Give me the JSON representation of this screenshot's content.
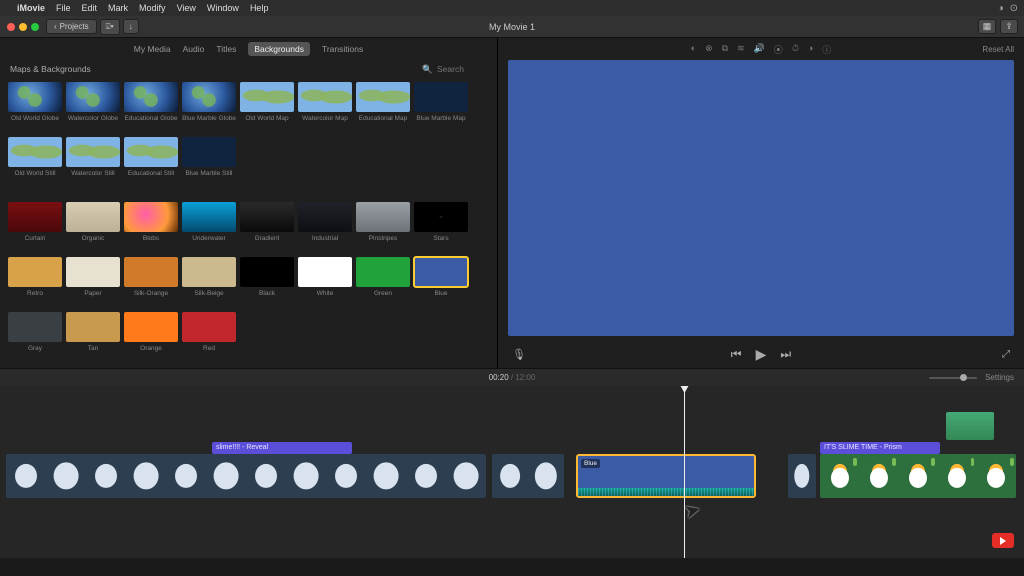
{
  "menubar": {
    "app": "iMovie",
    "items": [
      "File",
      "Edit",
      "Mark",
      "Modify",
      "View",
      "Window",
      "Help"
    ]
  },
  "toolbar": {
    "back_label": "Projects",
    "title": "My Movie 1"
  },
  "browser": {
    "tabs": {
      "my_media": "My Media",
      "audio": "Audio",
      "titles": "Titles",
      "backgrounds": "Backgrounds",
      "transitions": "Transitions"
    },
    "header": "Maps & Backgrounds",
    "search_placeholder": "Search",
    "row1": [
      {
        "label": "Old World Globe",
        "cls": "globe"
      },
      {
        "label": "Watercolor Globe",
        "cls": "globe"
      },
      {
        "label": "Educational Globe",
        "cls": "globe"
      },
      {
        "label": "Blue Marble Globe",
        "cls": "globe"
      },
      {
        "label": "Old World Map",
        "cls": "mapflat"
      },
      {
        "label": "Watercolor Map",
        "cls": "mapflat"
      },
      {
        "label": "Educational Map",
        "cls": "mapflat"
      },
      {
        "label": "Blue Marble Map",
        "cls": "mapdark"
      }
    ],
    "row2": [
      {
        "label": "Old World Still",
        "cls": "mapflat"
      },
      {
        "label": "Watercolor Still",
        "cls": "mapflat"
      },
      {
        "label": "Educational Still",
        "cls": "mapflat"
      },
      {
        "label": "Blue Marble Still",
        "cls": "mapdark"
      }
    ],
    "row3": [
      {
        "label": "Curtain",
        "bg": "linear-gradient(#7a0f12,#4a080a)"
      },
      {
        "label": "Organic",
        "bg": "linear-gradient(#d7cdb4,#bdb196)"
      },
      {
        "label": "Blobs",
        "bg": "radial-gradient(circle at 40% 40%,#ff5ea8,#ff9a3c 60%,#5a2a00)"
      },
      {
        "label": "Underwater",
        "bg": "linear-gradient(#0aa0d8,#034a6e)"
      },
      {
        "label": "Gradient",
        "bg": "linear-gradient(#2a2a2a,#0a0a0a)"
      },
      {
        "label": "Industrial",
        "bg": "linear-gradient(#1f2329,#0d0f12)"
      },
      {
        "label": "Pinstripes",
        "bg": "linear-gradient(#9aa0a6,#6d7278)"
      },
      {
        "label": "Stars",
        "bg": "radial-gradient(#222 0 1px, #000 2px)"
      }
    ],
    "row4": [
      {
        "label": "Retro",
        "bg": "#d8a24a"
      },
      {
        "label": "Paper",
        "bg": "#e7e1d2"
      },
      {
        "label": "Silk-Orange",
        "bg": "#d07a2a"
      },
      {
        "label": "Silk-Beige",
        "bg": "#cdb98e"
      },
      {
        "label": "Black",
        "bg": "#000000"
      },
      {
        "label": "White",
        "bg": "#ffffff"
      },
      {
        "label": "Green",
        "bg": "#1fa33a"
      },
      {
        "label": "Blue",
        "bg": "#3b5ba5",
        "selected": true
      }
    ],
    "row5": [
      {
        "label": "Gray",
        "bg": "#3a3f44"
      },
      {
        "label": "Tan",
        "bg": "#c79a4e"
      },
      {
        "label": "Orange",
        "bg": "#ff7a1a"
      },
      {
        "label": "Red",
        "bg": "#c1272d"
      }
    ]
  },
  "viewer": {
    "reset": "Reset All"
  },
  "timeline": {
    "current": "00:20",
    "total": "12:00",
    "settings": "Settings",
    "title1": "slime!!!! - Reveal",
    "title2": "IT'S SLIME TIME - Prism",
    "bg_clip_label": "Blue"
  }
}
